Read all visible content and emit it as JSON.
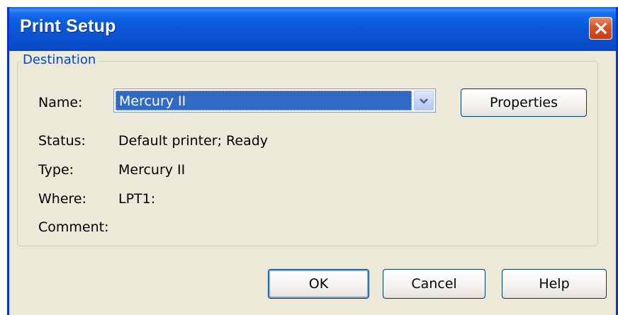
{
  "window": {
    "title": "Print Setup"
  },
  "destination": {
    "legend": "Destination",
    "name_label": "Name:",
    "printer_selected": "Mercury II",
    "properties_label": "Properties",
    "status_label": "Status:",
    "status_value": "Default printer; Ready",
    "type_label": "Type:",
    "type_value": "Mercury II",
    "where_label": "Where:",
    "where_value": "LPT1:",
    "comment_label": "Comment:",
    "comment_value": ""
  },
  "buttons": {
    "ok": "OK",
    "cancel": "Cancel",
    "help": "Help"
  },
  "colors": {
    "titlebar": "#0a5fd8",
    "dialog_bg": "#ece9d8",
    "selection": "#316ac5",
    "legend_text": "#0046d5",
    "close_button": "#d9552c"
  },
  "icons": {
    "close": "close-icon",
    "dropdown": "chevron-down-icon"
  }
}
